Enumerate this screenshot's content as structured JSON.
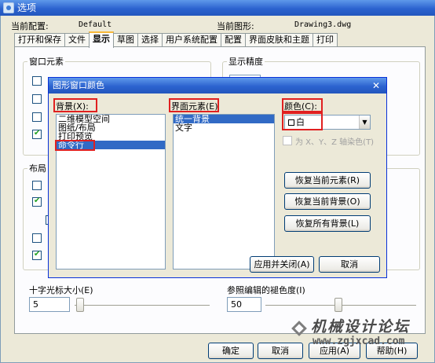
{
  "window": {
    "title": "选项"
  },
  "header": {
    "current_profile_label": "当前配置:",
    "current_profile_value": "Default",
    "current_drawing_label": "当前图形:",
    "current_drawing_value": "Drawing3.dwg"
  },
  "tabs": [
    {
      "label": "打开和保存",
      "active": false
    },
    {
      "label": "文件",
      "active": false
    },
    {
      "label": "显示",
      "active": true
    },
    {
      "label": "草图",
      "active": false
    },
    {
      "label": "选择",
      "active": false
    },
    {
      "label": "用户系统配置",
      "active": false
    },
    {
      "label": "配置",
      "active": false
    },
    {
      "label": "界面皮肤和主题",
      "active": false
    },
    {
      "label": "打印",
      "active": false
    }
  ],
  "display": {
    "window_elements_title": "窗口元素",
    "display_precision_title": "显示精度",
    "layout_title": "布局",
    "crosshair_size_label": "十字光标大小(E)",
    "crosshair_size_value": "5",
    "xref_fade_label": "参照编辑的褪色度(I)",
    "xref_fade_value": "50"
  },
  "dialog": {
    "title": "图形窗口颜色",
    "background_label": "背景(X):",
    "background_items": [
      "二维模型空间",
      "图纸/布局",
      "打印预览",
      "命令行"
    ],
    "background_selected": 3,
    "element_label": "界面元素(E)",
    "element_items": [
      "统一背景",
      "文字"
    ],
    "element_selected": 0,
    "color_label": "颜色(C):",
    "color_value": "白",
    "tint_checkbox_label": "为 X、Y、Z 轴染色(T)",
    "restore_element_button": "恢复当前元素(R)",
    "restore_background_button": "恢复当前背景(O)",
    "restore_all_button": "恢复所有背景(L)",
    "apply_close_button": "应用并关闭(A)",
    "cancel_button": "取消"
  },
  "footer": {
    "ok_button": "确定",
    "cancel_button": "取消",
    "apply_button": "应用(A)",
    "help_button": "帮助(H)"
  },
  "watermark": {
    "line1": "机械设计论坛",
    "line2": "www.zgjxcad.com"
  },
  "colors": {
    "titlebar": "#2c63cf",
    "selection": "#316ac5",
    "highlight_box": "#e02020",
    "dialog_face": "#ece9d8"
  }
}
